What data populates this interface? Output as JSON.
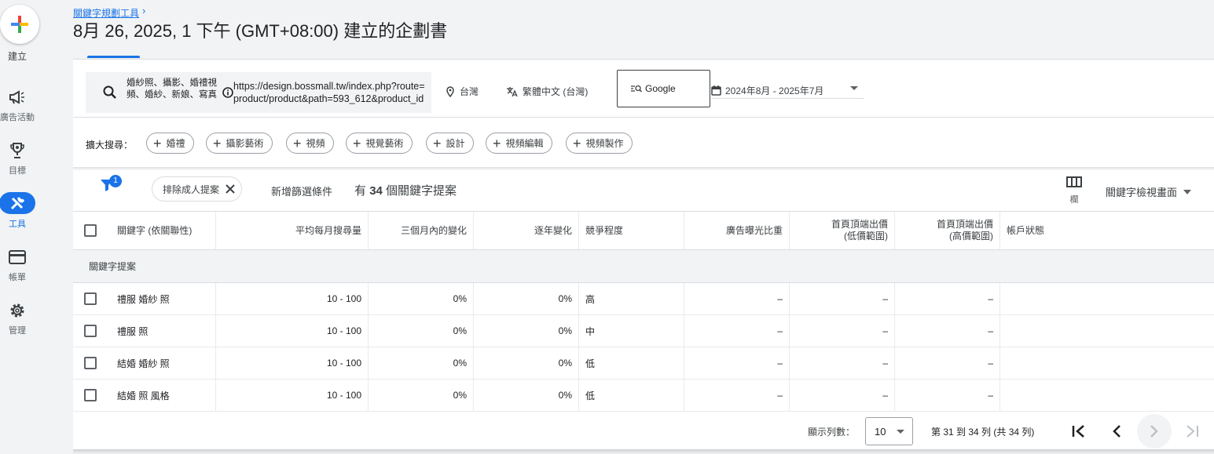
{
  "nav": {
    "create_label": "建立",
    "items": [
      {
        "label": "廣告活動",
        "icon": "megaphone-icon"
      },
      {
        "label": "目標",
        "icon": "trophy-icon"
      },
      {
        "label": "工具",
        "icon": "tools-icon"
      },
      {
        "label": "帳單",
        "icon": "credit-card-icon"
      },
      {
        "label": "管理",
        "icon": "gear-icon"
      }
    ]
  },
  "header": {
    "breadcrumb": "關鍵字規劃工具",
    "title": "8月 26, 2025, 1 下午 (GMT+08:00) 建立的企劃書"
  },
  "search": {
    "keywords": "婚紗照、攝影、婚禮視頻、婚紗、新娘、寫真",
    "url": "https://design.bossmall.tw/index.php?route=product/product&path=593_612&product_id"
  },
  "filters": {
    "location": "台灣",
    "language": "繁體中文 (台灣)",
    "network": "Google",
    "date_range": "2024年8月 - 2025年7月"
  },
  "expand": {
    "label": "擴大搜尋：",
    "chips": [
      "婚禮",
      "攝影藝術",
      "視頻",
      "視覺藝術",
      "設計",
      "視頻編輯",
      "視頻製作"
    ]
  },
  "toolbar": {
    "filter_badge": "1",
    "adult_chip": "排除成人提案",
    "add_filter": "新增篩選條件",
    "count_prefix": "有",
    "count": "34",
    "count_suffix": "個關鍵字提案",
    "columns_label": "欄",
    "view_label": "關鍵字檢視畫面"
  },
  "table": {
    "headers": [
      "關鍵字 (依關聯性)",
      "平均每月搜尋量",
      "三個月內的變化",
      "逐年變化",
      "競爭程度",
      "廣告曝光比重",
      "首頁頂端出價\n(低價範圍)",
      "首頁頂端出價\n(高價範圍)",
      "帳戶狀態"
    ],
    "group_label": "關鍵字提案",
    "rows": [
      {
        "keyword": "禮服 婚紗 照",
        "volume": "10 - 100",
        "three_month": "0%",
        "yoy": "0%",
        "competition": "高",
        "impression_share": "–",
        "bid_low": "–",
        "bid_high": "–",
        "status": ""
      },
      {
        "keyword": "禮服 照",
        "volume": "10 - 100",
        "three_month": "0%",
        "yoy": "0%",
        "competition": "中",
        "impression_share": "–",
        "bid_low": "–",
        "bid_high": "–",
        "status": ""
      },
      {
        "keyword": "結婚 婚紗 照",
        "volume": "10 - 100",
        "three_month": "0%",
        "yoy": "0%",
        "competition": "低",
        "impression_share": "–",
        "bid_low": "–",
        "bid_high": "–",
        "status": ""
      },
      {
        "keyword": "結婚 照 風格",
        "volume": "10 - 100",
        "three_month": "0%",
        "yoy": "0%",
        "competition": "低",
        "impression_share": "–",
        "bid_low": "–",
        "bid_high": "–",
        "status": ""
      }
    ]
  },
  "pagination": {
    "rows_label": "顯示列數：",
    "rows_value": "10",
    "range_text": "第 31 到 34 列 (共 34 列)"
  }
}
